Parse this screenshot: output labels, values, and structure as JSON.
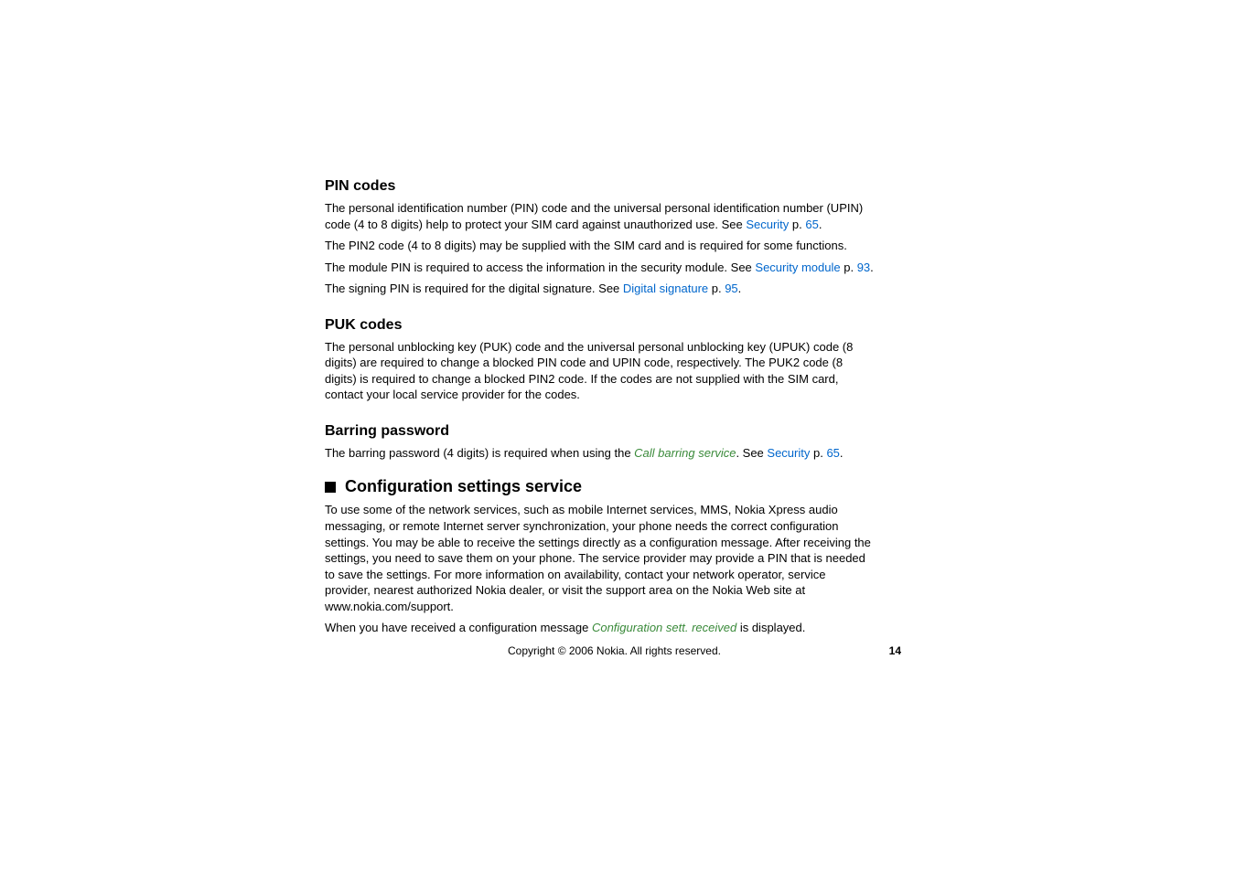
{
  "sections": {
    "pin": {
      "heading": "PIN codes",
      "p1a": "The personal identification number (PIN) code and the universal personal identification number (UPIN) code (4 to 8 digits) help to protect your SIM card against unauthorized use. See ",
      "p1_link1": "Security",
      "p1b": " p. ",
      "p1_link2": "65",
      "p1c": ".",
      "p2": "The PIN2 code (4 to 8 digits) may be supplied with the SIM card and is required for some functions.",
      "p3a": "The module PIN is required to access the information in the security module. See ",
      "p3_link1": "Security module",
      "p3b": " p. ",
      "p3_link2": "93",
      "p3c": ".",
      "p4a": "The signing PIN is required for the digital signature. See ",
      "p4_link1": "Digital signature",
      "p4b": " p. ",
      "p4_link2": "95",
      "p4c": "."
    },
    "puk": {
      "heading": "PUK codes",
      "p1": "The personal unblocking key (PUK) code and the universal personal unblocking key (UPUK) code (8 digits) are required to change a blocked PIN code and UPIN code, respectively. The PUK2 code (8 digits) is required to change a blocked PIN2 code. If the codes are not supplied with the SIM card, contact your local service provider for the codes."
    },
    "barring": {
      "heading": "Barring password",
      "p1a": "The barring password (4 digits) is required when using the ",
      "p1_italic": "Call barring service",
      "p1b": ". See ",
      "p1_link1": "Security",
      "p1c": " p. ",
      "p1_link2": "65",
      "p1d": "."
    },
    "config": {
      "heading": "Configuration settings service",
      "p1": "To use some of the network services, such as mobile Internet services, MMS, Nokia Xpress audio messaging, or remote Internet server synchronization, your phone needs the correct configuration settings. You may be able to receive the settings directly as a configuration message. After receiving the settings, you need to save them on your phone. The service provider may provide a PIN that is needed to save the settings. For more information on availability, contact your network operator, service provider, nearest authorized Nokia dealer, or visit the support area on the Nokia Web site at www.nokia.com/support.",
      "p2a": "When you have received a configuration message ",
      "p2_italic": "Configuration sett. received",
      "p2b": " is displayed."
    }
  },
  "footer": {
    "copyright": "Copyright © 2006 Nokia. All rights reserved.",
    "page": "14"
  }
}
